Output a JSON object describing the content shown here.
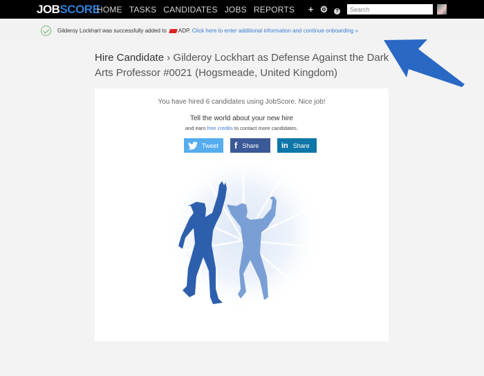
{
  "topbar": {
    "logo_job": "JOB",
    "logo_score": "SCORE",
    "nav": [
      {
        "label": "HOME"
      },
      {
        "label": "TASKS"
      },
      {
        "label": "CANDIDATES"
      },
      {
        "label": "JOBS"
      },
      {
        "label": "REPORTS"
      }
    ],
    "icons": {
      "add": "+",
      "settings": "⚙",
      "help": "?"
    },
    "search_placeholder": "Search"
  },
  "notice": {
    "text": "Gilderoy Lockhart was successfully added to",
    "adp": "ADP.",
    "link": "Click here to enter additional information and continue onboarding »"
  },
  "page": {
    "crumb": "Hire Candidate",
    "separator": "›",
    "title": "Gilderoy Lockhart as Defense Against the Dark Arts Professor #0021 (Hogsmeade, United Kingdom)"
  },
  "card": {
    "hired_text": "You have hired 6 candidates using JobScore. Nice job!",
    "tell_text": "Tell the world about your new hire",
    "earn_prefix": "and earn",
    "earn_link": "free credits",
    "earn_suffix": "to contact more candidates.",
    "buttons": {
      "tweet": {
        "glyph": "🐦",
        "label": "Tweet"
      },
      "facebook": {
        "glyph": "f",
        "label": "Share"
      },
      "linkedin": {
        "glyph": "in",
        "label": "Share"
      }
    }
  },
  "colors": {
    "brand_blue": "#2e7fd6",
    "twitter": "#55acee",
    "facebook": "#3b5998",
    "linkedin": "#0e76a8",
    "annotation_arrow": "#2a68c6"
  }
}
